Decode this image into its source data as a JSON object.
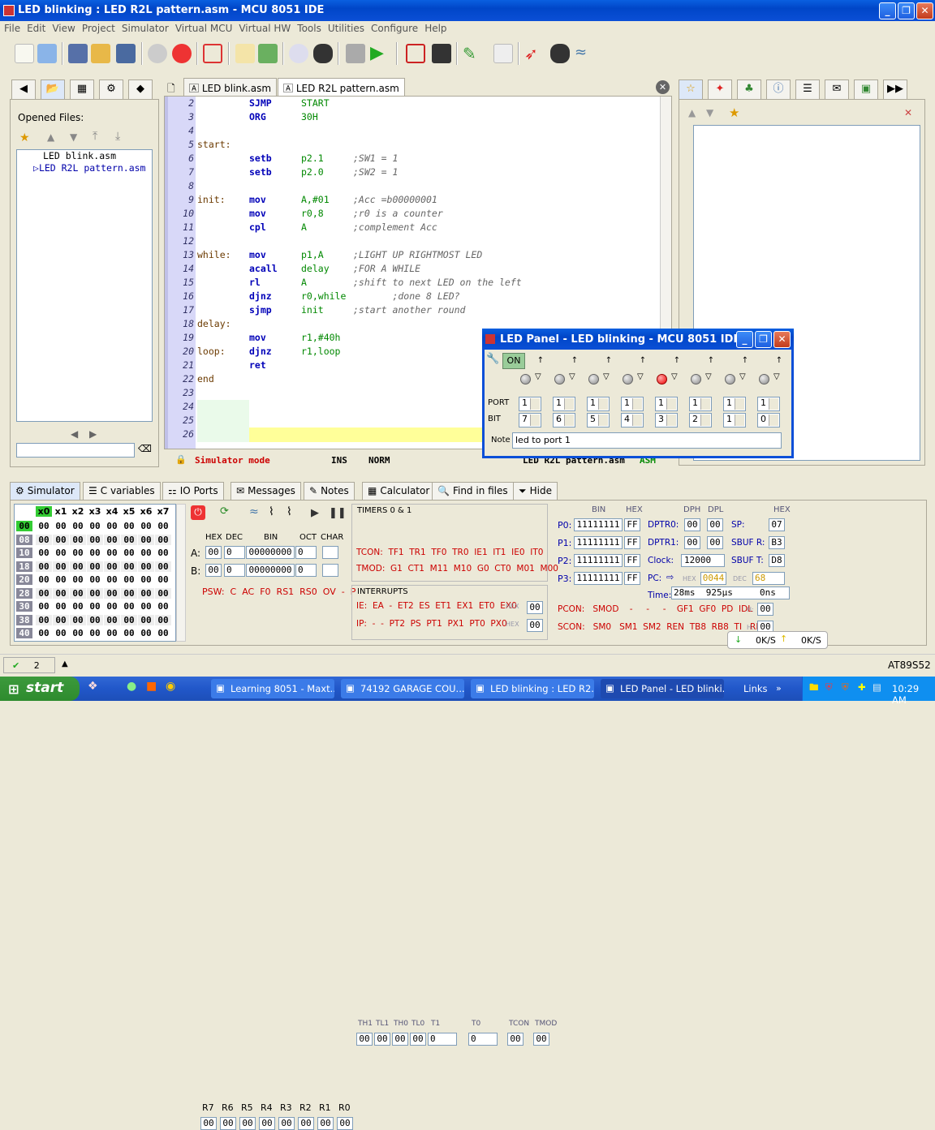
{
  "window": {
    "title": "LED blinking : LED R2L pattern.asm - MCU 8051 IDE"
  },
  "menu": [
    "File",
    "Edit",
    "View",
    "Project",
    "Simulator",
    "Virtual MCU",
    "Virtual HW",
    "Tools",
    "Utilities",
    "Configure",
    "Help"
  ],
  "left_panel": {
    "heading": "Opened Files:",
    "files": [
      "LED blink.asm",
      "LED R2L pattern.asm"
    ]
  },
  "editor": {
    "tabs": [
      "LED blink.asm",
      "LED R2L pattern.asm"
    ],
    "lines": [
      {
        "n": "2",
        "label": "",
        "op": "SJMP",
        "arg": "START",
        "cmt": ""
      },
      {
        "n": "3",
        "label": "",
        "op": "ORG",
        "arg": "30H",
        "cmt": ""
      },
      {
        "n": "4",
        "label": "",
        "op": "",
        "arg": "",
        "cmt": ""
      },
      {
        "n": "5",
        "label": "start:",
        "op": "",
        "arg": "",
        "cmt": ""
      },
      {
        "n": "6",
        "label": "",
        "op": "setb",
        "arg": "p2.1",
        "cmt": ";SW1 = 1"
      },
      {
        "n": "7",
        "label": "",
        "op": "setb",
        "arg": "p2.0",
        "cmt": ";SW2 = 1"
      },
      {
        "n": "8",
        "label": "",
        "op": "",
        "arg": "",
        "cmt": ""
      },
      {
        "n": "9",
        "label": "init:",
        "op": "mov",
        "arg": "A,#01",
        "cmt": ";Acc =b00000001"
      },
      {
        "n": "10",
        "label": "",
        "op": "mov",
        "arg": "r0,8",
        "cmt": ";r0 is a counter"
      },
      {
        "n": "11",
        "label": "",
        "op": "cpl",
        "arg": "A",
        "cmt": ";complement Acc"
      },
      {
        "n": "12",
        "label": "",
        "op": "",
        "arg": "",
        "cmt": ""
      },
      {
        "n": "13",
        "label": "while:",
        "op": "mov",
        "arg": "p1,A",
        "cmt": ";LIGHT UP RIGHTMOST LED"
      },
      {
        "n": "14",
        "label": "",
        "op": "acall",
        "arg": "delay",
        "cmt": ";FOR A WHILE"
      },
      {
        "n": "15",
        "label": "",
        "op": "rl",
        "arg": "A",
        "cmt": ";shift to next LED on the left"
      },
      {
        "n": "16",
        "label": "",
        "op": "djnz",
        "arg": "r0,while",
        "cmt": "       ;done 8 LED?"
      },
      {
        "n": "17",
        "label": "",
        "op": "sjmp",
        "arg": "init",
        "cmt": ";start another round"
      },
      {
        "n": "18",
        "label": "delay:",
        "op": "",
        "arg": "",
        "cmt": ""
      },
      {
        "n": "19",
        "label": "",
        "op": "mov",
        "arg": "r1,#40h",
        "cmt": ""
      },
      {
        "n": "20",
        "label": "loop:",
        "op": "djnz",
        "arg": "r1,loop",
        "cmt": ""
      },
      {
        "n": "21",
        "label": "",
        "op": "ret",
        "arg": "",
        "cmt": ""
      },
      {
        "n": "22",
        "label": "end",
        "op": "",
        "arg": "",
        "cmt": ""
      },
      {
        "n": "23",
        "label": "",
        "op": "",
        "arg": "",
        "cmt": ""
      },
      {
        "n": "24",
        "label": "",
        "op": "",
        "arg": "",
        "cmt": ""
      },
      {
        "n": "25",
        "label": "",
        "op": "",
        "arg": "",
        "cmt": ""
      },
      {
        "n": "26",
        "label": "",
        "op": "",
        "arg": "",
        "cmt": ""
      }
    ],
    "status": {
      "mode": "Simulator mode",
      "ins": "INS",
      "norm": "NORM",
      "file": "LED R2L pattern.asm",
      "type": "ASM"
    }
  },
  "led_panel": {
    "title": "LED Panel - LED blinking - MCU 8051 IDE",
    "on_label": "ON",
    "port_label": "PORT",
    "bit_label": "BIT",
    "note_label": "Note",
    "note_value": "led to port 1",
    "leds": [
      {
        "port": "1",
        "bit": "7",
        "lit": false
      },
      {
        "port": "1",
        "bit": "6",
        "lit": false
      },
      {
        "port": "1",
        "bit": "5",
        "lit": false
      },
      {
        "port": "1",
        "bit": "4",
        "lit": false
      },
      {
        "port": "1",
        "bit": "3",
        "lit": true
      },
      {
        "port": "1",
        "bit": "2",
        "lit": false
      },
      {
        "port": "1",
        "bit": "1",
        "lit": false
      },
      {
        "port": "1",
        "bit": "0",
        "lit": false
      }
    ]
  },
  "bottom_tabs": [
    "Simulator",
    "C variables",
    "IO Ports",
    "Messages",
    "Notes",
    "Calculator",
    "Find in files",
    "Hide"
  ],
  "simulator": {
    "mem_header": [
      "x0",
      "x1",
      "x2",
      "x3",
      "x4",
      "x5",
      "x6",
      "x7"
    ],
    "mem_rows": [
      "00",
      "08",
      "10",
      "18",
      "20",
      "28",
      "30",
      "38",
      "40"
    ],
    "reg_labels": {
      "hex": "HEX",
      "dec": "DEC",
      "bin": "BIN",
      "oct": "OCT",
      "char": "CHAR"
    },
    "A": {
      "label": "A:",
      "hex": "00",
      "dec": "0",
      "bin": "00000000",
      "oct": "0"
    },
    "B": {
      "label": "B:",
      "hex": "00",
      "dec": "0",
      "bin": "00000000",
      "oct": "0"
    },
    "psw": "PSW:  C  AC  F0  RS1  RS0  OV  -  P",
    "regs": [
      "R7",
      "R6",
      "R5",
      "R4",
      "R3",
      "R2",
      "R1",
      "R0"
    ],
    "reg_vals": [
      "00",
      "00",
      "00",
      "00",
      "00",
      "00",
      "00",
      "00"
    ],
    "timers_title": "TIMERS 0 & 1",
    "timer_heads": [
      "TH1",
      "TL1",
      "TH0",
      "TL0",
      "T1",
      "T0",
      "TCON",
      "TMOD"
    ],
    "timer_vals": [
      "00",
      "00",
      "00",
      "00",
      "0",
      "0",
      "00",
      "00"
    ],
    "tcon": "TCON:  TF1  TR1  TF0  TR0  IE1  IT1  IE0  IT0",
    "tmod": "TMOD:  G1  CT1  M11  M10  G0  CT0  M01  M00",
    "interrupts_title": "INTERRUPTS",
    "ie": "IE:  EA  -  ET2  ES  ET1  EX1  ET0  EX0",
    "ip": "IP:  -  -  PT2  PS  PT1  PX1  PT0  PX0",
    "int_hex": "HEX",
    "ie_val": "00",
    "ip_val": "00",
    "ports": [
      {
        "label": "P0:",
        "bin": "11111111",
        "hex": "FF"
      },
      {
        "label": "P1:",
        "bin": "11111111",
        "hex": "FF"
      },
      {
        "label": "P2:",
        "bin": "11111111",
        "hex": "FF"
      },
      {
        "label": "P3:",
        "bin": "11111111",
        "hex": "FF"
      }
    ],
    "bin_head": "BIN",
    "hex_head": "HEX",
    "dptr0": {
      "label": "DPTR0:",
      "dph": "00",
      "dpl": "00"
    },
    "dptr1": {
      "label": "DPTR1:",
      "dph": "00",
      "dpl": "00"
    },
    "dph": "DPH",
    "dpl": "DPL",
    "clock": {
      "label": "Clock:",
      "value": "12000"
    },
    "pc": {
      "label": "PC:",
      "hex_lbl": "HEX",
      "hex": "0044",
      "dec_lbl": "DEC",
      "dec": "68"
    },
    "sp": {
      "label": "SP:",
      "value": "07"
    },
    "sbufr": {
      "label": "SBUF R:",
      "value": "B3"
    },
    "sbuft": {
      "label": "SBUF T:",
      "value": "D8"
    },
    "time": {
      "label": "Time:",
      "value": "28ms  925µs     0ns"
    },
    "pcon": "PCON:   SMOD    -     -     -    GF1  GF0  PD  IDL",
    "scon": "SCON:   SM0   SM1  SM2  REN  TB8  RB8  TI   RI",
    "h_lbl": "H:",
    "pcon_val": "00",
    "scon_val": "00",
    "transfer": {
      "down": "0K/S",
      "up": "0K/S"
    }
  },
  "statusbar": {
    "spell": "2",
    "chip": "AT89S52"
  },
  "taskbar": {
    "start": "start",
    "tasks": [
      "Learning 8051 - Maxt...",
      "74192 GARAGE COU...",
      "LED blinking : LED R2...",
      "LED Panel - LED blinki..."
    ],
    "links": "Links",
    "clock": "10:29 AM"
  }
}
